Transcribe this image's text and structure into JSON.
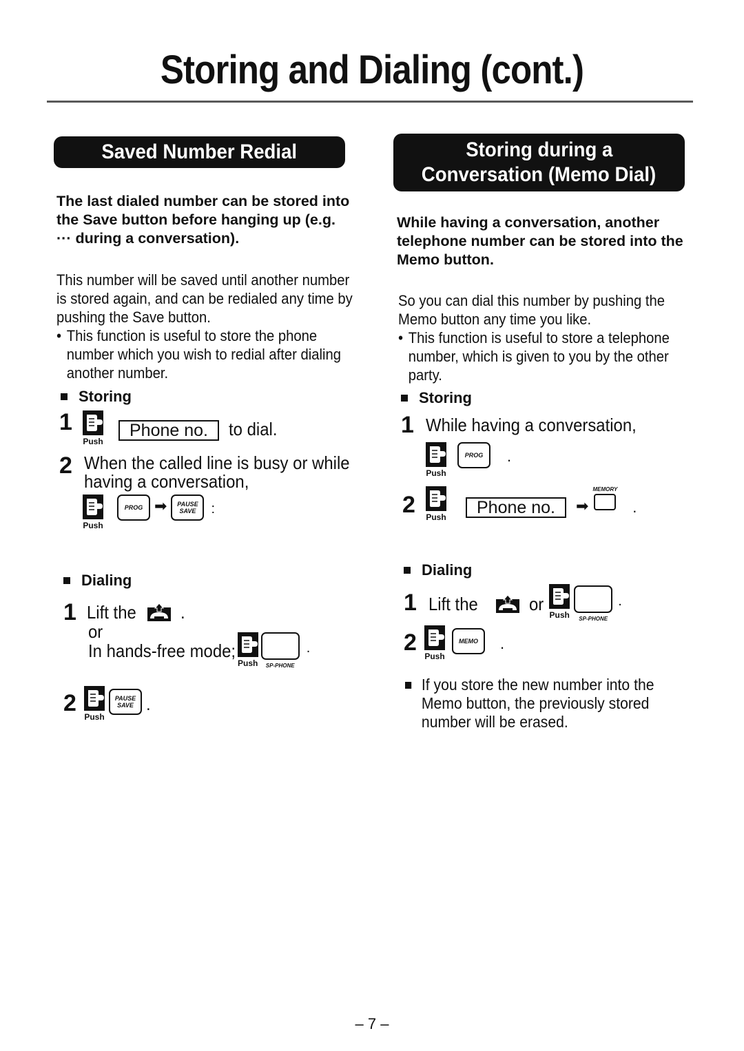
{
  "page": {
    "title": "Storing and Dialing (cont.)",
    "page_number": "– 7 –"
  },
  "left": {
    "banner": "Saved Number Redial",
    "intro": "The last dialed number can be stored into the Save button before hanging up (e.g. ··· during a conversation).",
    "body": "This number will be saved until another number is stored again, and can be redialed any time by pushing the Save button.",
    "bullet": "This function is useful to store the phone number which you wish to redial after dialing another number.",
    "storing": {
      "heading": "Storing",
      "step1": {
        "num": "1",
        "push": "Push",
        "phone_box": "Phone no.",
        "suffix": "to dial."
      },
      "step2": {
        "num": "2",
        "text": "When the called line is busy or while having a conversation,",
        "push": "Push",
        "key1": "PROG",
        "key2_line1": "PAUSE",
        "key2_line2": "SAVE",
        "end": ":"
      }
    },
    "dialing": {
      "heading": "Dialing",
      "step1": {
        "num": "1",
        "text": "Lift the",
        "end": ".",
        "or": "or",
        "handsfree": "In hands-free mode;",
        "push": "Push",
        "key_label": "SP-PHONE",
        "end2": "."
      },
      "step2": {
        "num": "2",
        "push": "Push",
        "key_line1": "PAUSE",
        "key_line2": "SAVE",
        "end": "."
      }
    }
  },
  "right": {
    "banner_line1": "Storing during a",
    "banner_line2": "Conversation (Memo Dial)",
    "intro": "While having a conversation, another telephone number can be stored into the Memo button.",
    "body": "So you can dial this number by pushing the Memo button any time you like.",
    "bullet": "This function is useful to store a telephone number, which is given to you by the other party.",
    "storing": {
      "heading": "Storing",
      "step1": {
        "num": "1",
        "text": "While having a conversation,",
        "push": "Push",
        "key": "PROG",
        "end": "."
      },
      "step2": {
        "num": "2",
        "push": "Push",
        "phone_box": "Phone no.",
        "key_label": "MEMORY",
        "end": "."
      }
    },
    "dialing": {
      "heading": "Dialing",
      "step1": {
        "num": "1",
        "text": "Lift the",
        "or": "or",
        "push": "Push",
        "key_label": "SP-PHONE",
        "end": "."
      },
      "step2": {
        "num": "2",
        "push": "Push",
        "key": "MEMO",
        "end": "."
      }
    },
    "note": "If you store the new number into the Memo button, the previously stored number will be erased."
  }
}
